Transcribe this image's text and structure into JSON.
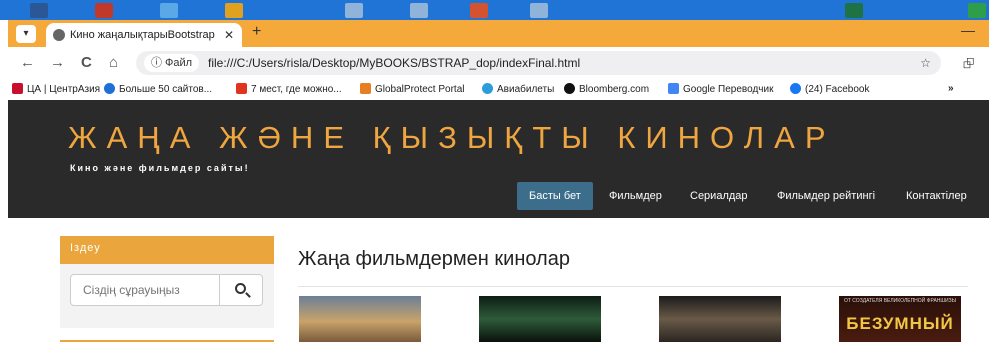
{
  "browser": {
    "tab_title": "Кино жаңалықтарыBootstrap",
    "tab_close": "✕",
    "new_tab": "+",
    "window_minimize": "—",
    "chip_label": "ⓘ Файл",
    "url": "file:///C:/Users/risla/Desktop/MyBOOKS/BSTRAP_dop/indexFinal.html",
    "nav_icons": {
      "back": "←",
      "forward": "→",
      "reload": "C",
      "home": "⌂",
      "star": "☆",
      "extension": "⮺"
    }
  },
  "bookmarks": [
    {
      "label": "ЦА | ЦентрАзия",
      "icon": "centrasia-icon",
      "color": "#c8102e"
    },
    {
      "label": "Больше 50 сайтов...",
      "icon": "globe-icon",
      "color": "#1e6fd6"
    },
    {
      "label": "7 мест, где можно...",
      "icon": "red-square-icon",
      "color": "#e0341f"
    },
    {
      "label": "GlobalProtect Portal",
      "icon": "globalprotect-icon",
      "color": "#e67e22"
    },
    {
      "label": "Авиабилеты",
      "icon": "plane-icon",
      "color": "#2e9cdb"
    },
    {
      "label": "Bloomberg.com",
      "icon": "bloomberg-icon",
      "color": "#111111"
    },
    {
      "label": "Google Переводчик",
      "icon": "translate-icon",
      "color": "#4285f4"
    },
    {
      "label": "(24) Facebook",
      "icon": "facebook-icon",
      "color": "#1877f2"
    }
  ],
  "bookmarks_more": "»",
  "site": {
    "title": "ЖАҢА ЖӘНЕ ҚЫЗЫҚТЫ КИНОЛАР",
    "subtitle": "Кино және фильмдер сайты!",
    "nav": [
      "Басты бет",
      "Фильмдер",
      "Сериалдар",
      "Фильмдер рейтингі",
      "Контактілер"
    ],
    "active_nav": "Басты бет",
    "accent": "#eba53d"
  },
  "sidebar": {
    "heading": "Іздеу",
    "search_placeholder": "Сіздің сұрауыңыз"
  },
  "main": {
    "section_title": "Жаңа фильмдермен кинолар",
    "poster_caption": "БЕЗУМНЫЙ",
    "poster_tagline": "ОТ СОЗДАТЕЛЯ ВЕЛИКОЛЕПНОЙ ФРАНШИЗЫ"
  }
}
